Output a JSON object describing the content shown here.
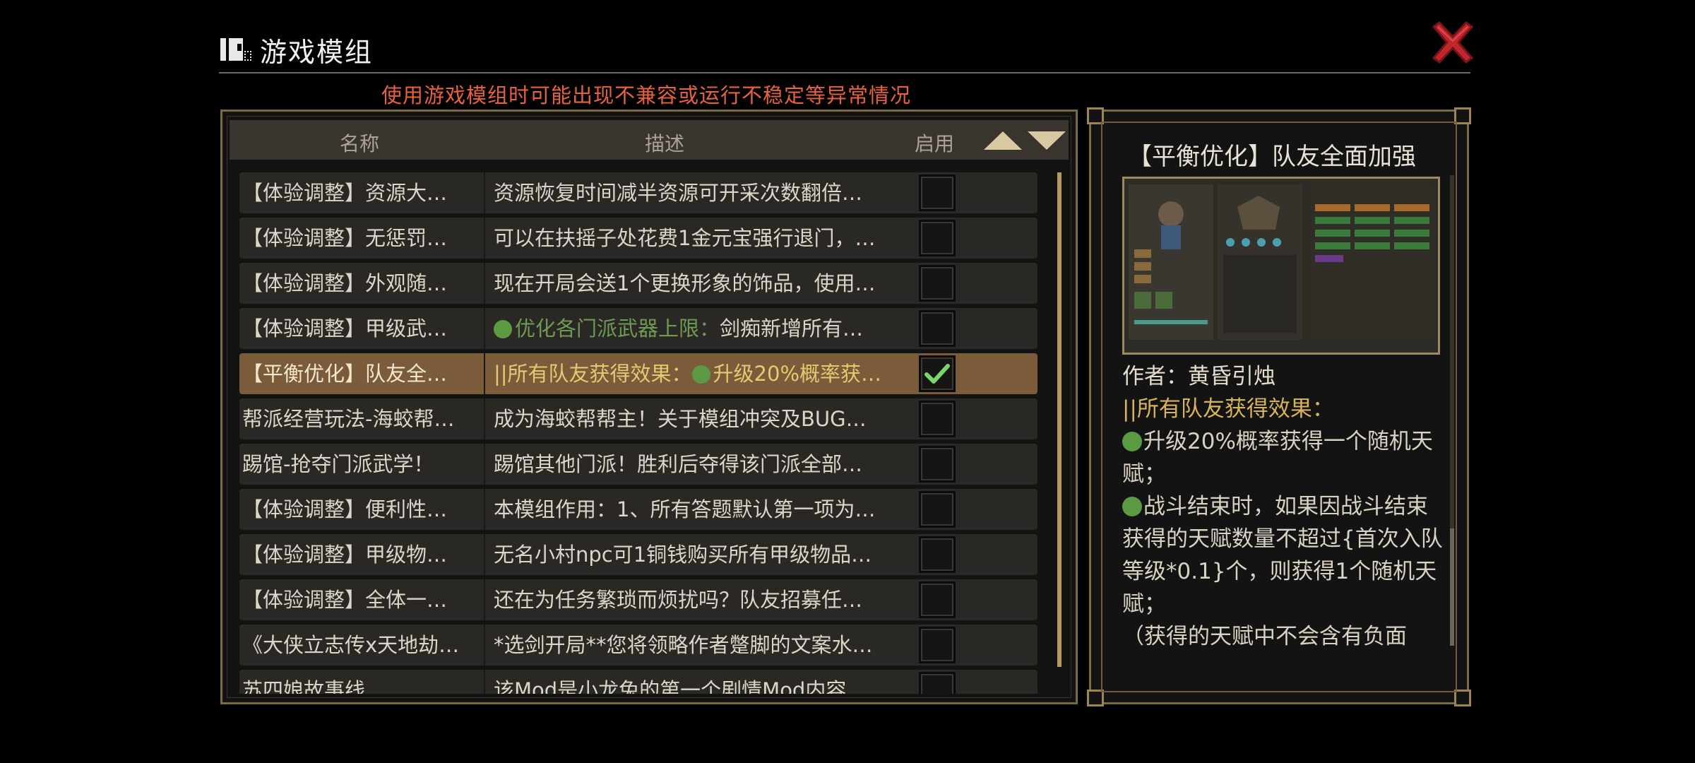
{
  "window": {
    "title": "游戏模组",
    "warning": "使用游戏模组时可能出现不兼容或运行不稳定等异常情况"
  },
  "list": {
    "headers": {
      "name": "名称",
      "description": "描述",
      "enable": "启用"
    },
    "rows": [
      {
        "name": "【体验调整】资源大…",
        "desc": "资源恢复时间减半资源可开采次数翻倍…",
        "enabled": false
      },
      {
        "name": "【体验调整】无惩罚…",
        "desc": "可以在扶摇子处花费1金元宝强行退门，…",
        "enabled": false
      },
      {
        "name": "【体验调整】外观随…",
        "desc": "现在开局会送1个更换形象的饰品，使用…",
        "enabled": false
      },
      {
        "name": "【体验调整】甲级武…",
        "desc_green": "优化各门派武器上限：",
        "desc": "剑痴新增所有…",
        "enabled": false
      },
      {
        "name": "【平衡优化】队友全…",
        "desc": "||所有队友获得效果：",
        "desc_dot": "升级20%概率获…",
        "enabled": true,
        "selected": true
      },
      {
        "name": "帮派经营玩法-海蛟帮…",
        "desc": "成为海蛟帮帮主！关于模组冲突及BUG…",
        "enabled": false
      },
      {
        "name": "踢馆-抢夺门派武学！",
        "desc": "踢馆其他门派！胜利后夺得该门派全部…",
        "enabled": false
      },
      {
        "name": "【体验调整】便利性…",
        "desc": "本模组作用：1、所有答题默认第一项为…",
        "enabled": false
      },
      {
        "name": "【体验调整】甲级物…",
        "desc": "无名小村npc可1铜钱购买所有甲级物品…",
        "enabled": false
      },
      {
        "name": "【体验调整】全体一…",
        "desc": "还在为任务繁琐而烦扰吗？队友招募任…",
        "enabled": false
      },
      {
        "name": "《大侠立志传x天地劫…",
        "desc": "*选剑开局**您将领略作者蹩脚的文案水…",
        "enabled": false
      },
      {
        "name": "苏四娘故事线",
        "desc": "该Mod是小龙兔的第一个剧情Mod内容…",
        "enabled": false
      }
    ]
  },
  "detail": {
    "title": "【平衡优化】队友全面加强",
    "author_label": "作者：黄昏引烛",
    "line1": "||所有队友获得效果：",
    "line2": "升级20%概率获得一个随机天赋；",
    "line3": "战斗结束时，如果因战斗结束获得的天赋数量不超过{首次入队等级*0.1}个，则获得1个随机天赋；",
    "line4": "（获得的天赋中不会含有负面"
  },
  "colors": {
    "background": "#000000",
    "warning": "#e8613c",
    "gold_border": "#7b6a46",
    "selected_row": "#7a5c3a",
    "gold_text": "#d7b45a",
    "green_dot": "#5a9a43",
    "check": "#7ad66a",
    "close_icon": "#c0262d"
  },
  "icons": {
    "close": "close-x-icon",
    "sort_up": "triangle-up-icon",
    "sort_down": "triangle-down-icon",
    "title": "mod-puzzle-icon"
  }
}
